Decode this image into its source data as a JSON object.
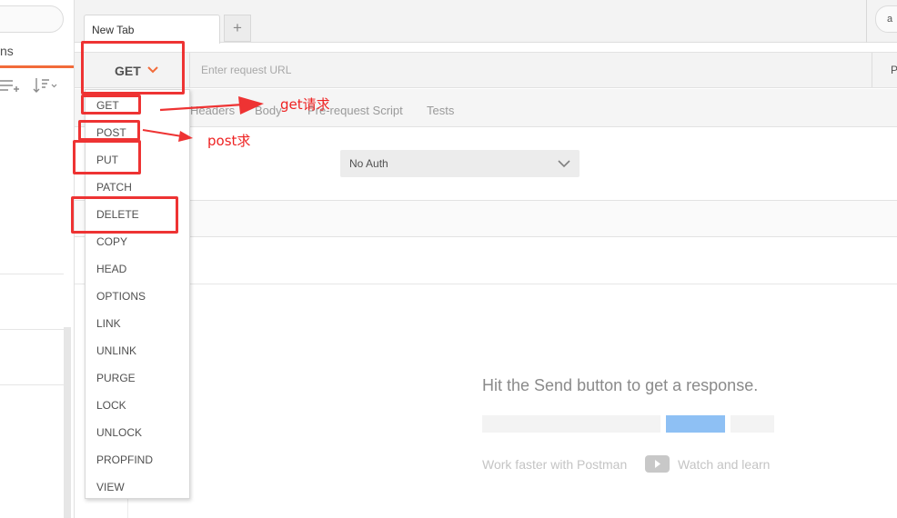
{
  "sidebar": {
    "tab_label": "ns",
    "new_folder_icon": "new-collection-icon",
    "sort_icon": "sort-icon"
  },
  "tabs": {
    "items": [
      {
        "label": "New Tab"
      }
    ],
    "add_label": "+",
    "env_search_label": "a"
  },
  "request": {
    "method": "GET",
    "url_placeholder": "Enter request URL",
    "params_label": "P"
  },
  "request_tabs": [
    {
      "label": "Headers"
    },
    {
      "label": "Body"
    },
    {
      "label": "Pre-request Script"
    },
    {
      "label": "Tests"
    }
  ],
  "auth": {
    "selected": "No Auth"
  },
  "methods_menu": {
    "items": [
      "GET",
      "POST",
      "PUT",
      "PATCH",
      "DELETE",
      "COPY",
      "HEAD",
      "OPTIONS",
      "LINK",
      "UNLINK",
      "PURGE",
      "LOCK",
      "UNLOCK",
      "PROPFIND",
      "VIEW"
    ]
  },
  "response": {
    "empty_message": "Hit the Send button to get a response.",
    "work_faster": "Work faster with Postman",
    "watch_learn": "Watch and learn",
    "video_icon": "play-video-icon"
  },
  "annotations": {
    "get_note": "get请求",
    "post_note": "post求",
    "color": "#ee3333"
  },
  "colors": {
    "accent": "#f26b3a",
    "send_placeholder": "#8ec0f4"
  }
}
